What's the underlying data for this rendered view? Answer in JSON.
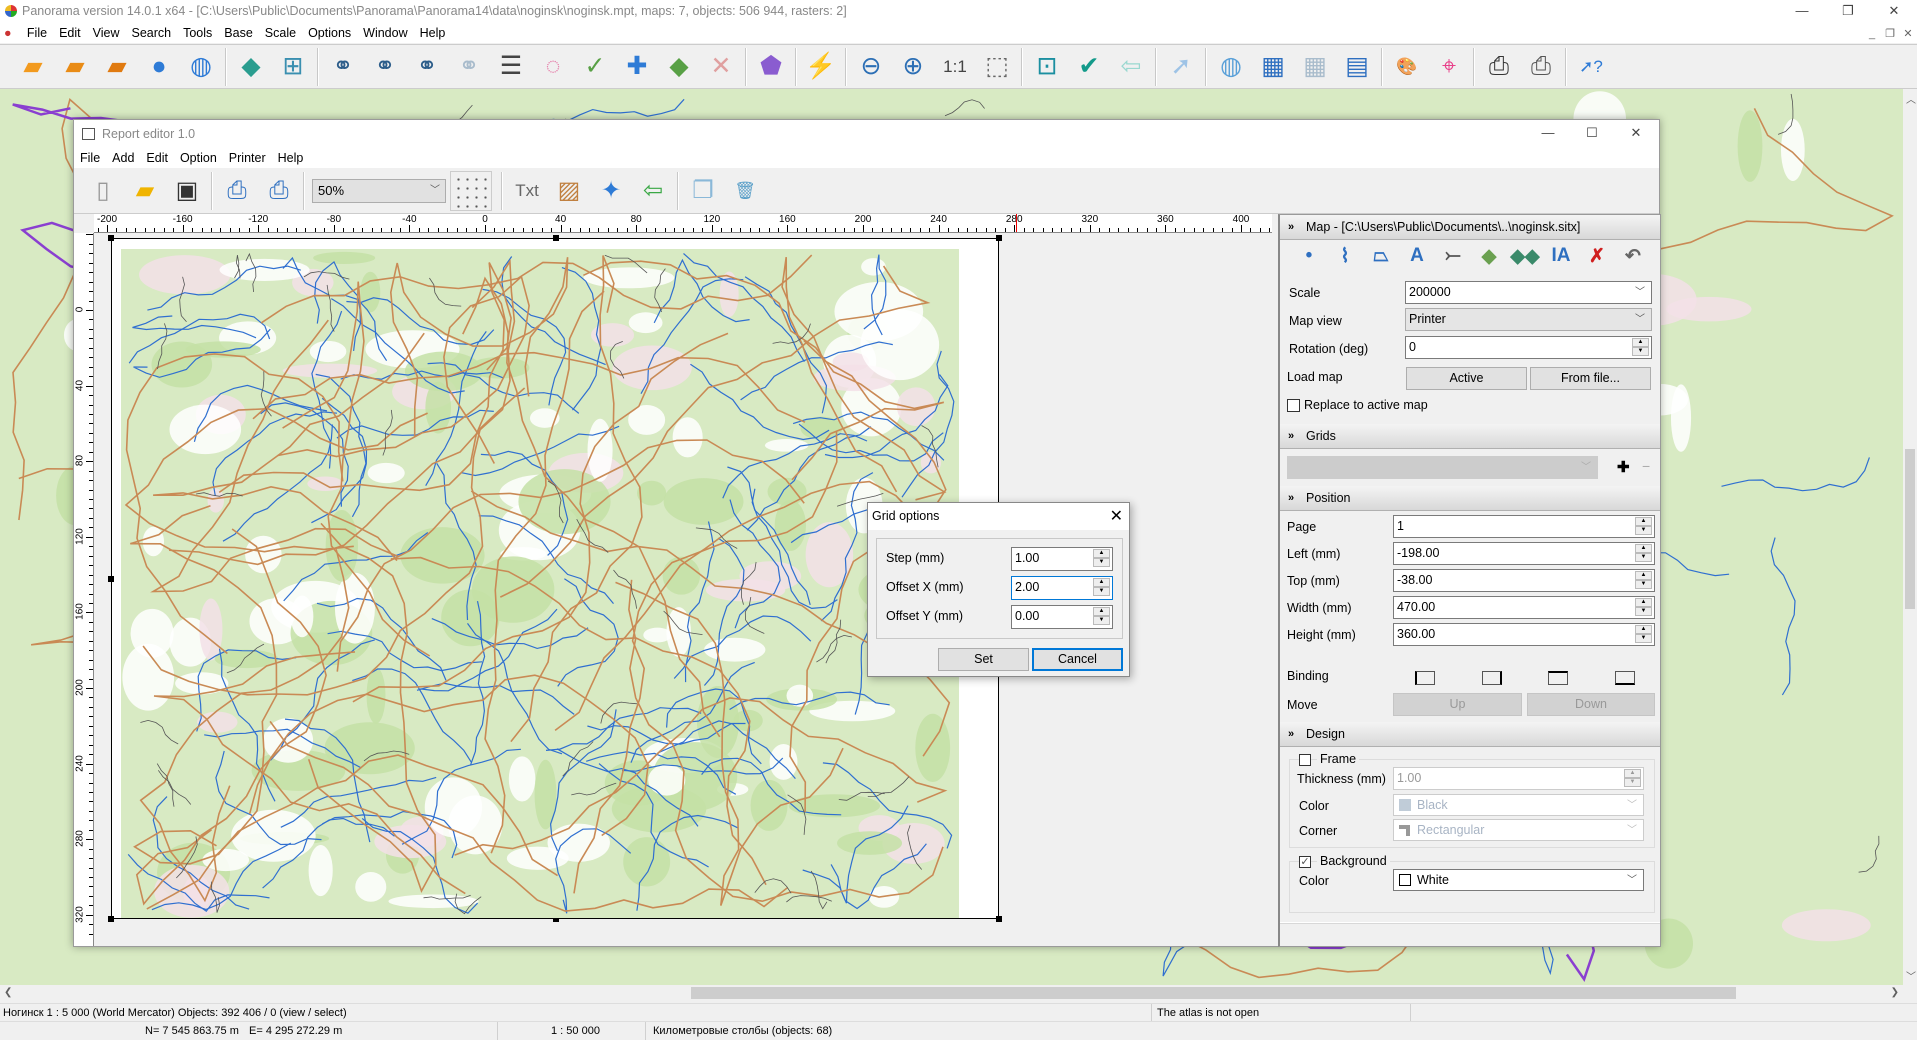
{
  "app": {
    "title": "Panorama version 14.0.1 x64 - [C:\\Users\\Public\\Documents\\Panorama\\Panorama14\\data\\noginsk\\noginsk.mpt, maps: 7, objects: 506 944, rasters: 2]",
    "menu": [
      "File",
      "Edit",
      "View",
      "Search",
      "Tools",
      "Base",
      "Scale",
      "Options",
      "Window",
      "Help"
    ],
    "toolbar": [
      {
        "name": "open-map-icon",
        "glyph": "▰",
        "color": "#f29a1e"
      },
      {
        "name": "open-remote-icon",
        "glyph": "▰",
        "color": "#e98b15"
      },
      {
        "name": "open-dbm-icon",
        "glyph": "▰",
        "color": "#e07a10"
      },
      {
        "name": "open-globe-icon",
        "glyph": "●",
        "color": "#2e7bd6"
      },
      {
        "name": "globe-list-icon",
        "glyph": "◍",
        "color": "#2e7bd6"
      },
      "|",
      {
        "name": "layers-icon",
        "glyph": "◆",
        "color": "#2a9d8f"
      },
      {
        "name": "legend-tree-icon",
        "glyph": "⊞",
        "color": "#3a8fb0"
      },
      "|",
      {
        "name": "binoculars-icon",
        "glyph": "⚭",
        "color": "#2c5d8a"
      },
      {
        "name": "binoculars-text-icon",
        "glyph": "⚭",
        "color": "#2c5d8a"
      },
      {
        "name": "binoculars-more-icon",
        "glyph": "⚭",
        "color": "#2c5d8a"
      },
      {
        "name": "binoculars-disabled-icon",
        "glyph": "⚭",
        "color": "#a9bccc"
      },
      {
        "name": "list-icon",
        "glyph": "☰",
        "color": "#444"
      },
      {
        "name": "select-area-icon",
        "glyph": "◌",
        "color": "#e46fa0"
      },
      {
        "name": "select-check-icon",
        "glyph": "✓",
        "color": "#58a045"
      },
      {
        "name": "select-add-icon",
        "glyph": "✚",
        "color": "#2e7bd6"
      },
      {
        "name": "select-all-icon",
        "glyph": "◆",
        "color": "#58a045"
      },
      {
        "name": "select-clear-icon",
        "glyph": "✕",
        "color": "#e0a0a0"
      },
      "|",
      {
        "name": "shapes-icon",
        "glyph": "⬟",
        "color": "#8a5cd0"
      },
      "|",
      {
        "name": "lightning-icon",
        "glyph": "⚡",
        "color": "#f5a800"
      },
      "|",
      {
        "name": "zoom-out-icon",
        "glyph": "⊖",
        "color": "#2c6fb5"
      },
      {
        "name": "zoom-in-icon",
        "glyph": "⊕",
        "color": "#2c6fb5"
      },
      {
        "name": "zoom-1to1-icon",
        "glyph": "1:1",
        "color": "#444"
      },
      {
        "name": "zoom-fit-icon",
        "glyph": "⬚",
        "color": "#666"
      },
      "|",
      {
        "name": "frame-window-icon",
        "glyph": "⊡",
        "color": "#1b8fa0"
      },
      {
        "name": "check-icon",
        "glyph": "✔",
        "color": "#139a8a"
      },
      {
        "name": "back-arrow-icon",
        "glyph": "⇦",
        "color": "#9ad8d0"
      },
      "|",
      {
        "name": "pointer-icon",
        "glyph": "➚",
        "color": "#9ec3e6"
      },
      "|",
      {
        "name": "globe-pointer-icon",
        "glyph": "◍",
        "color": "#5aa0d8"
      },
      {
        "name": "table-pointer-icon",
        "glyph": "▦",
        "color": "#2e6fc0"
      },
      {
        "name": "dbm-pointer-icon",
        "glyph": "▦",
        "color": "#a9bccc"
      },
      {
        "name": "form-text-icon",
        "glyph": "▤",
        "color": "#2e6fc0"
      },
      "|",
      {
        "name": "palette-icon",
        "glyph": "🎨",
        "color": "#c0702a"
      },
      {
        "name": "route-ruler-icon",
        "glyph": "⌖",
        "color": "#e8408a"
      },
      "|",
      {
        "name": "printer-icon",
        "glyph": "⎙",
        "color": "#333"
      },
      {
        "name": "print-report-icon",
        "glyph": "⎙",
        "color": "#555"
      },
      "|",
      {
        "name": "help-pointer-icon",
        "glyph": "➚?",
        "color": "#2e7bd6"
      }
    ]
  },
  "report": {
    "title": "Report editor 1.0",
    "menu": [
      "File",
      "Add",
      "Edit",
      "Option",
      "Printer",
      "Help"
    ],
    "zoom": "50%",
    "toolbar_left": [
      {
        "name": "new-page-icon",
        "glyph": "▯",
        "color": "#999"
      },
      {
        "name": "open-folder-icon",
        "glyph": "▰",
        "color": "#f0b400"
      },
      {
        "name": "save-icon",
        "glyph": "▣",
        "color": "#333"
      },
      "|",
      {
        "name": "print-icon",
        "glyph": "⎙",
        "color": "#2e6fc0"
      },
      {
        "name": "print-preview-icon",
        "glyph": "⎙",
        "color": "#2e6fc0"
      },
      "|"
    ],
    "toolbar_right": [
      "|",
      {
        "name": "add-text-icon",
        "glyph": "Txt",
        "color": "#666"
      },
      {
        "name": "add-image-icon",
        "glyph": "▨",
        "color": "#c08040"
      },
      {
        "name": "add-compass-icon",
        "glyph": "✦",
        "color": "#2e7bd6"
      },
      {
        "name": "import-icon",
        "glyph": "⇦",
        "color": "#3aa845"
      },
      "|",
      {
        "name": "copy-page-icon",
        "glyph": "❐",
        "color": "#8ab8d8"
      },
      {
        "name": "trash-icon",
        "glyph": "🗑",
        "color": "#5a9fc8"
      }
    ],
    "ruler_h": [
      "-200",
      "-160",
      "-120",
      "-80",
      "-40",
      "0",
      "40",
      "80",
      "120",
      "160",
      "200",
      "240",
      "280",
      "320",
      "360",
      "400"
    ],
    "ruler_v": [
      "0",
      "40",
      "80",
      "120",
      "160",
      "200",
      "240",
      "280",
      "320"
    ],
    "cursor_mm": 281
  },
  "panel": {
    "map_header": "Map - [C:\\Users\\Public\\Documents\\..\\noginsk.sitx]",
    "tools": [
      {
        "name": "point-icon",
        "glyph": "•",
        "color": "#2e6fc0"
      },
      {
        "name": "polyline-icon",
        "glyph": "⌇",
        "color": "#2e6fc0"
      },
      {
        "name": "polygon-icon",
        "glyph": "⏢",
        "color": "#2e6fc0"
      },
      {
        "name": "text-icon",
        "glyph": "A",
        "color": "#2e6fc0"
      },
      {
        "name": "vector-icon",
        "glyph": "⤚",
        "color": "#555"
      },
      {
        "name": "move-object-icon",
        "glyph": "◆",
        "color": "#6aa050"
      },
      {
        "name": "copy-objects-icon",
        "glyph": "◆◆",
        "color": "#3a8a6a"
      },
      {
        "name": "text-cursor-icon",
        "glyph": "IA",
        "color": "#2e6fc0"
      },
      {
        "name": "delete-object-icon",
        "glyph": "✗",
        "color": "#d02020"
      },
      {
        "name": "undo-icon",
        "glyph": "↶",
        "color": "#666"
      }
    ],
    "scale_label": "Scale",
    "scale_value": "200000",
    "mapview_label": "Map view",
    "mapview_value": "Printer",
    "rotation_label": "Rotation (deg)",
    "rotation_value": "0",
    "loadmap_label": "Load map",
    "active_btn": "Active",
    "fromfile_btn": "From file...",
    "replace_label": "Replace to active map",
    "replace_checked": false,
    "grids_header": "Grids",
    "grids_value": "",
    "position_header": "Position",
    "page_label": "Page",
    "page_value": "1",
    "left_label": "Left (mm)",
    "left_value": "-198.00",
    "top_label": "Top (mm)",
    "top_value": "-38.00",
    "width_label": "Width (mm)",
    "width_value": "470.00",
    "height_label": "Height (mm)",
    "height_value": "360.00",
    "binding_label": "Binding",
    "move_label": "Move",
    "up_btn": "Up",
    "down_btn": "Down",
    "design_header": "Design",
    "frame_label": "Frame",
    "frame_checked": false,
    "thickness_label": "Thickness (mm)",
    "thickness_value": "1.00",
    "frame_color_label": "Color",
    "frame_color_value": "Black",
    "corner_label": "Corner",
    "corner_value": "Rectangular",
    "background_label": "Background",
    "background_checked": true,
    "bg_color_label": "Color",
    "bg_color_value": "White"
  },
  "dialog": {
    "title": "Grid options",
    "step_label": "Step (mm)",
    "step_value": "1.00",
    "offx_label": "Offset X (mm)",
    "offx_value": "2.00",
    "offy_label": "Offset Y (mm)",
    "offy_value": "0.00",
    "set_btn": "Set",
    "cancel_btn": "Cancel"
  },
  "status": {
    "map_info": "Ногинск  1 : 5 000 (World Mercator) Objects: 392 406 / 0 (view / select)",
    "atlas": "The atlas is not open",
    "north": "N= 7 545 863.75 m",
    "east": "E= 4 295 272.29 m",
    "scale": "1 : 50 000",
    "layer": "Километровые столбы   (objects: 68)"
  },
  "colors": {
    "accent": "#0078d7",
    "map_green": "#d8eac3",
    "river": "#2f6fd0",
    "road": "#c98a55",
    "boundary": "#8a3fd0"
  }
}
